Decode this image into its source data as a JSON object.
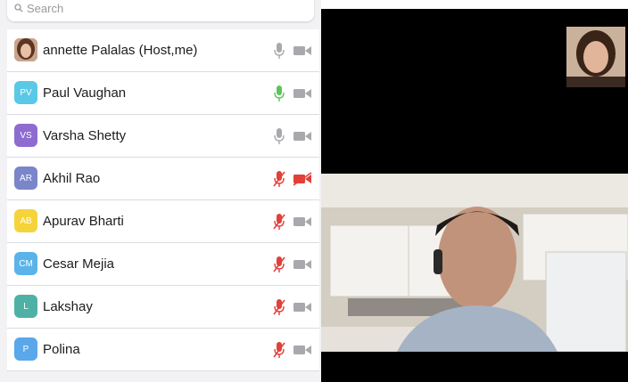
{
  "search": {
    "placeholder": "Search"
  },
  "participants": [
    {
      "name": "annette Palalas (Host,me)",
      "initials": "",
      "avatar_color": "#8a5a44",
      "mic": "off-gray",
      "cam": "off-gray"
    },
    {
      "name": "Paul Vaughan",
      "initials": "PV",
      "avatar_color": "#5ac8e6",
      "mic": "on-green",
      "cam": "off-gray"
    },
    {
      "name": "Varsha Shetty",
      "initials": "VS",
      "avatar_color": "#8e6ccf",
      "mic": "off-gray",
      "cam": "off-gray"
    },
    {
      "name": "Akhil Rao",
      "initials": "AR",
      "avatar_color": "#7a86c9",
      "mic": "muted-red",
      "cam": "muted-red"
    },
    {
      "name": "Apurav Bharti",
      "initials": "AB",
      "avatar_color": "#f5d43b",
      "mic": "muted-red",
      "cam": "off-gray"
    },
    {
      "name": "Cesar Mejia",
      "initials": "CM",
      "avatar_color": "#5ab4ea",
      "mic": "muted-red",
      "cam": "off-gray"
    },
    {
      "name": "Lakshay",
      "initials": "L",
      "avatar_color": "#4fb1a6",
      "mic": "muted-red",
      "cam": "off-gray"
    },
    {
      "name": "Polina",
      "initials": "P",
      "avatar_color": "#5aa7ea",
      "mic": "muted-red",
      "cam": "off-gray"
    }
  ],
  "colors": {
    "gray_icon": "#a9a9ad",
    "green_icon": "#5cc45a",
    "red_icon": "#e2403a"
  }
}
